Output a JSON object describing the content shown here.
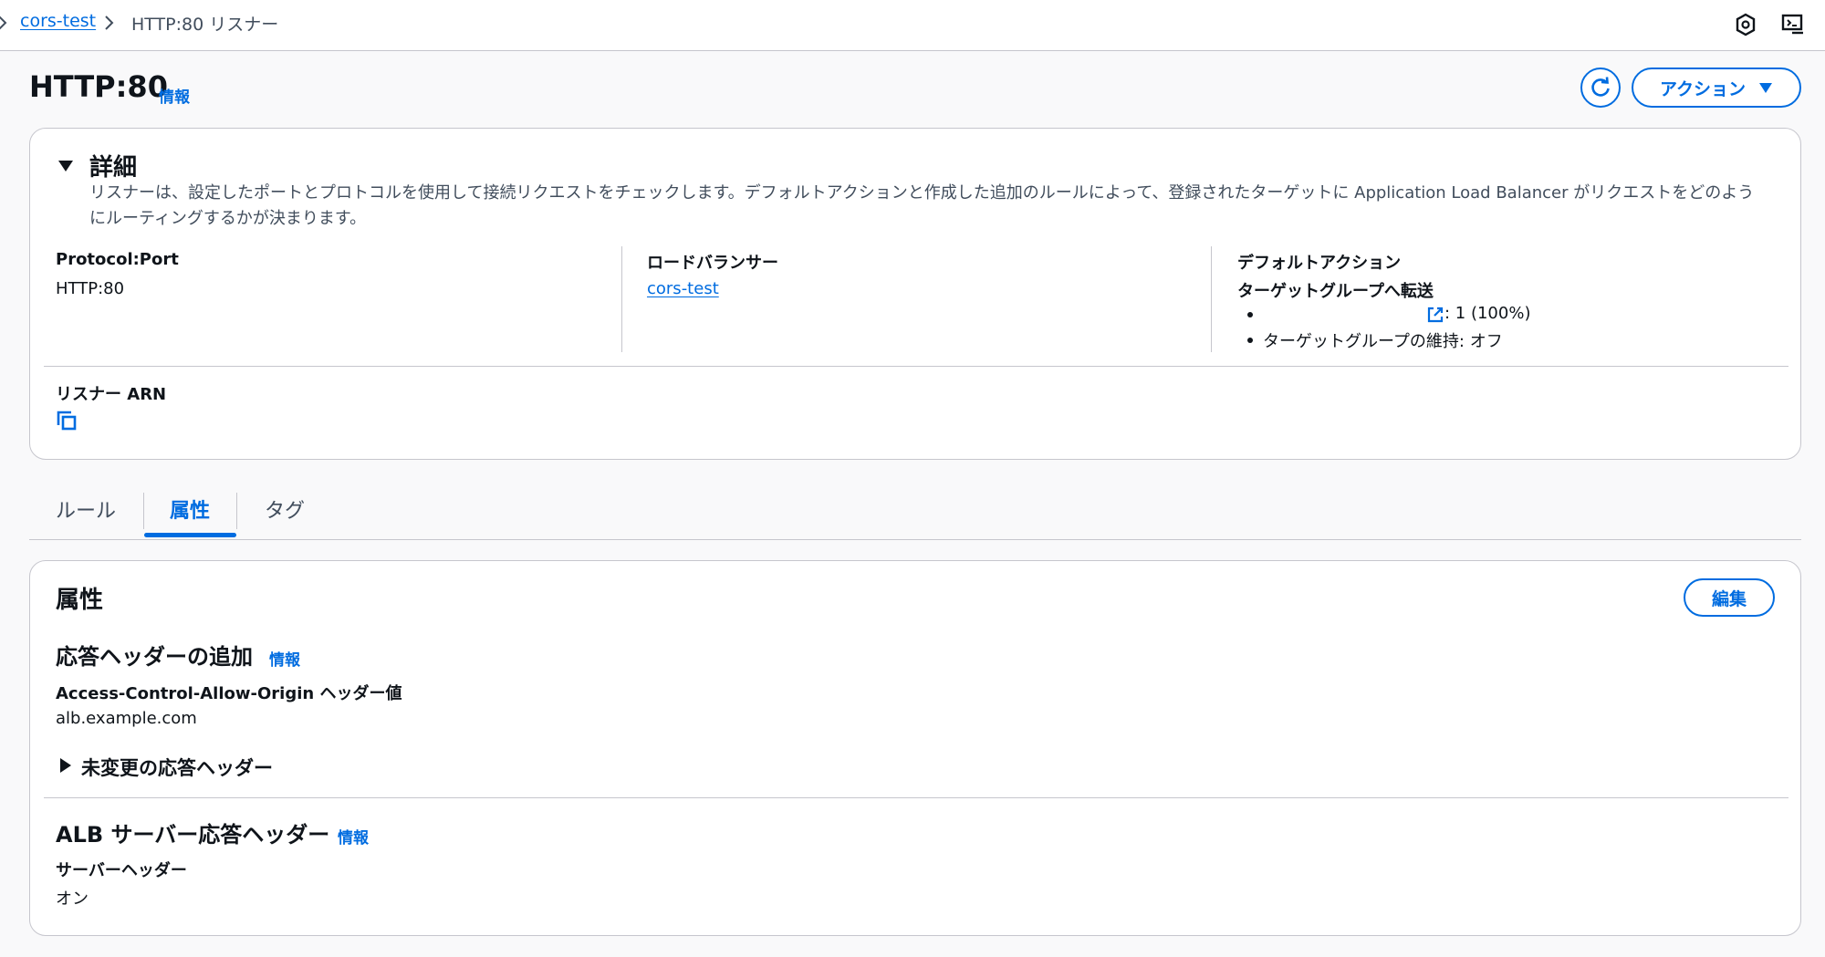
{
  "breadcrumb": {
    "items": [
      "cors-test",
      "HTTP:80 リスナー"
    ]
  },
  "header": {
    "title": "HTTP:80",
    "info": "情報",
    "actions_label": "アクション"
  },
  "details": {
    "title": "詳細",
    "description": "リスナーは、設定したポートとプロトコルを使用して接続リクエストをチェックします。デフォルトアクションと作成した追加のルールによって、登録されたターゲットに Application Load Balancer がリクエストをどのようにルーティングするかが決まります。",
    "protocol_label": "Protocol:Port",
    "protocol_value": "HTTP:80",
    "lb_label": "ロードバランサー",
    "lb_value": "cors-test",
    "default_action_label": "デフォルトアクション",
    "forward_label": "ターゲットグループへ転送",
    "target_weight": ": 1 (100%)",
    "stickiness": "ターゲットグループの維持: オフ",
    "arn_label": "リスナー ARN"
  },
  "tabs": [
    {
      "label": "ルール"
    },
    {
      "label": "属性"
    },
    {
      "label": "タグ"
    }
  ],
  "attributes": {
    "title": "属性",
    "edit_label": "編集",
    "response_headers_title": "応答ヘッダーの追加",
    "info": "情報",
    "acao_label": "Access-Control-Allow-Origin ヘッダー値",
    "acao_value": "alb.example.com",
    "unchanged_label": "未変更の応答ヘッダー",
    "server_headers_title": "ALB サーバー応答ヘッダー",
    "server_header_label": "サーバーヘッダー",
    "server_header_value": "オン"
  },
  "colors": {
    "accent": "#006ce0",
    "border": "#c6c6cd",
    "background": "#f9f9fa"
  }
}
